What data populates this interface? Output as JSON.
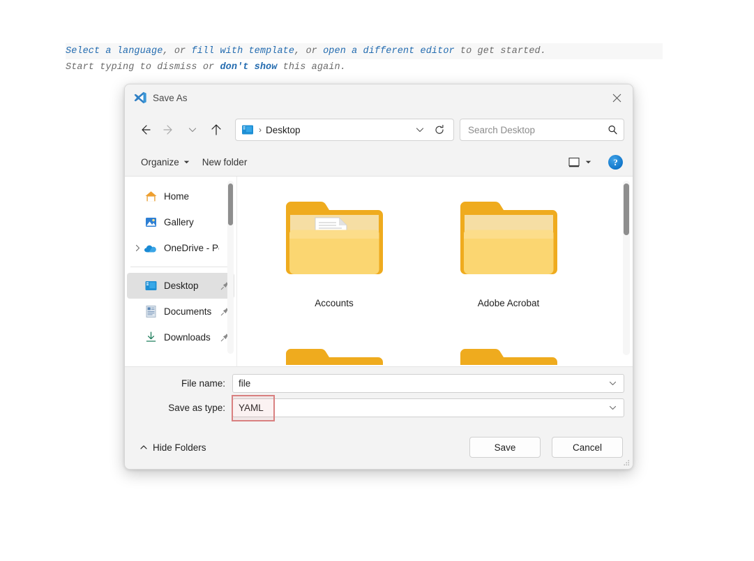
{
  "editor_hint": {
    "line1": {
      "link1": "Select a language",
      "text1": ", or ",
      "link2": "fill with template",
      "text2": ", or ",
      "link3": "open a different editor",
      "text3": " to get started."
    },
    "line2": {
      "text1": "Start typing to dismiss or ",
      "link1": "don't show",
      "text2": " this again."
    }
  },
  "dialog": {
    "title": "Save As",
    "app_icon": "vscode-icon",
    "close_label": "Close",
    "nav": {
      "back_icon": "arrow-left-icon",
      "forward_icon": "arrow-right-icon",
      "recent_icon": "chevron-down-icon",
      "up_icon": "arrow-up-icon",
      "breadcrumb_icon": "desktop-icon",
      "breadcrumb_separator": "›",
      "breadcrumb_path": "Desktop",
      "path_chevron_icon": "chevron-down-icon",
      "refresh_icon": "refresh-icon"
    },
    "search": {
      "placeholder": "Search Desktop",
      "value": "",
      "icon": "search-icon"
    },
    "toolbar": {
      "organize_label": "Organize",
      "organize_chevron": "chevron-down-icon",
      "new_folder_label": "New folder",
      "view_icon": "view-layout-icon",
      "view_chevron": "chevron-down-icon",
      "help_label": "?"
    },
    "sidebar": {
      "items": [
        {
          "label": "Home",
          "icon": "home-icon",
          "expandable": false,
          "pinned": false,
          "selected": false
        },
        {
          "label": "Gallery",
          "icon": "gallery-icon",
          "expandable": false,
          "pinned": false,
          "selected": false
        },
        {
          "label": "OneDrive - Perso",
          "icon": "onedrive-icon",
          "expandable": true,
          "pinned": false,
          "selected": false
        },
        {
          "label": "Desktop",
          "icon": "desktop-icon",
          "expandable": false,
          "pinned": true,
          "selected": true
        },
        {
          "label": "Documents",
          "icon": "documents-icon",
          "expandable": false,
          "pinned": true,
          "selected": false
        },
        {
          "label": "Downloads",
          "icon": "downloads-icon",
          "expandable": false,
          "pinned": true,
          "selected": false
        }
      ]
    },
    "files": [
      {
        "name": "Accounts",
        "type": "folder",
        "overlay": "document-stack"
      },
      {
        "name": "Adobe Acrobat",
        "type": "folder",
        "overlay": "acrobat-arc"
      }
    ],
    "form": {
      "file_name_label": "File name:",
      "file_name_value": "file",
      "file_name_chevron": "chevron-down-icon",
      "save_type_label": "Save as type:",
      "save_type_value": "YAML",
      "save_type_chevron": "chevron-down-icon",
      "highlight_color": "#d98080"
    },
    "footer": {
      "hide_folders_label": "Hide Folders",
      "hide_folders_icon": "chevron-up-icon",
      "save_label": "Save",
      "cancel_label": "Cancel",
      "resize_grip_icon": "resize-grip-icon"
    }
  }
}
